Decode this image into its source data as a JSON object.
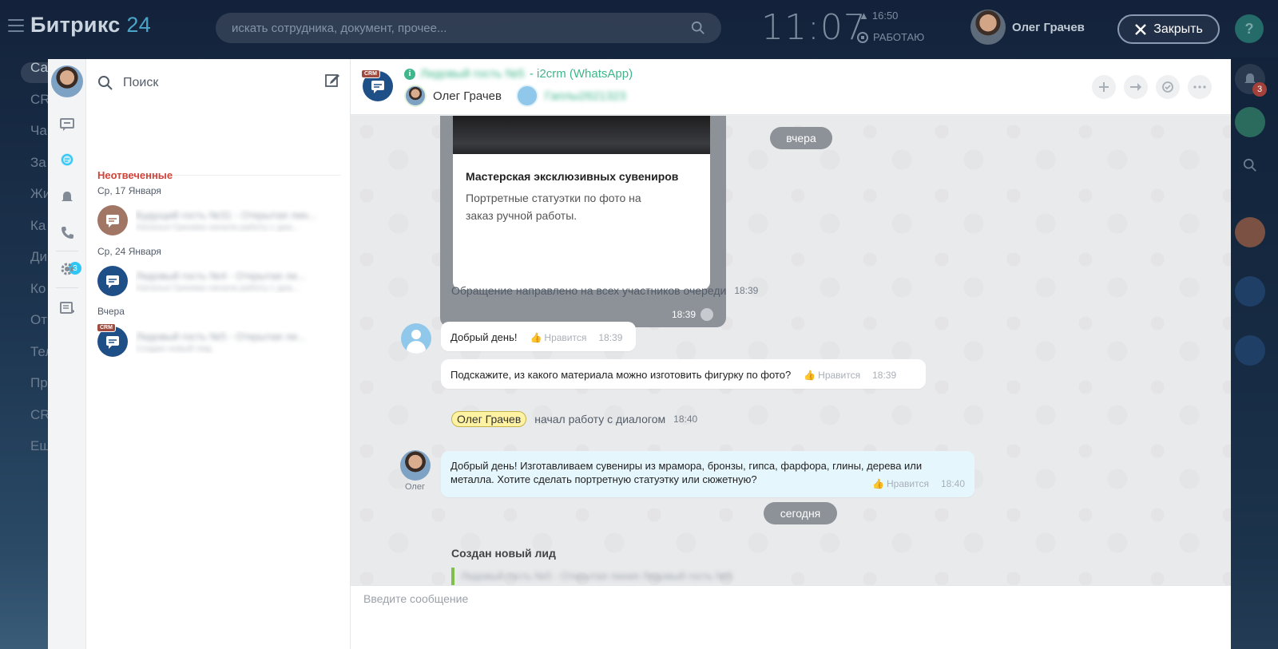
{
  "app": {
    "logo_main": "Битрикс",
    "logo_num": "24",
    "search_placeholder": "искать сотрудника, документ, прочее...",
    "clock": "11:07",
    "alarm_time": "16:50",
    "work_status": "РАБОТАЮ",
    "user_name": "Олег Грачев",
    "close_label": "Закрыть",
    "help_label": "?",
    "left_menu": [
      "Са",
      "CR",
      "Ча",
      "За",
      "Жи",
      "Ка",
      "Ди",
      "Ко",
      "От",
      "Тел",
      "Пр",
      "CR",
      "Ещ"
    ],
    "rail_notif_badge": "3"
  },
  "nav": {
    "notif_badge": "3"
  },
  "list": {
    "search_placeholder": "Поиск",
    "section_title": "Неотвеченные",
    "groups": [
      {
        "date": "Ср, 17 Января",
        "items": [
          {
            "title": "Будущий гость №31 - Открытая лин...",
            "preview": "Наталья Гринева начала работу с диа..."
          }
        ]
      },
      {
        "date": "Ср, 24 Января",
        "items": [
          {
            "title": "Лидовый гость №4 - Открытая ли...",
            "preview": "Наталья Гринева начала работу с диа..."
          }
        ]
      },
      {
        "date": "Вчера",
        "items": [
          {
            "title": "Лидовый гость №5 - Открытая ли...",
            "preview": "Создан новый лид",
            "tag": "CRM"
          }
        ]
      }
    ]
  },
  "chat": {
    "header": {
      "crm_tag": "CRM",
      "title_blurred": "Лидовый гость №5",
      "channel": "- i2crm (WhatsApp)",
      "member1": "Олег Грачев",
      "member2_blurred": "Гаплы2621323"
    },
    "date_yesterday": "вчера",
    "media": {
      "title": "Мастерская эксклюзивных сувениров",
      "desc": "Портретные статуэтки по фото на заказ ручной работы.",
      "time": "18:39"
    },
    "sys1": {
      "text": "Обращение направлено на всех участников очереди",
      "time": "18:39"
    },
    "msg1": {
      "text": "Добрый день!",
      "like": "Нравится",
      "time": "18:39"
    },
    "msg2": {
      "text": "Подскажите, из какого материала можно изготовить фигурку по фото?",
      "like": "Нравится",
      "time": "18:39"
    },
    "sys2": {
      "name": "Олег Грачев",
      "text": "начал работу с диалогом",
      "time": "18:40"
    },
    "msg3": {
      "text": "Добрый день! Изготавливаем сувениры из мрамора, бронзы, гипса, фарфора, глины, дерева или металла. Хотите сделать портретную статуэтку или сюжетную?",
      "like": "Нравится",
      "time": "18:40",
      "author_short": "Олег"
    },
    "date_today": "сегодня",
    "lead_title": "Создан новый лид",
    "lead_text_blurred": "Лидовый гость №5 - Открытая линия Лидовый гость №5",
    "input_placeholder": "Введите сообщение"
  }
}
